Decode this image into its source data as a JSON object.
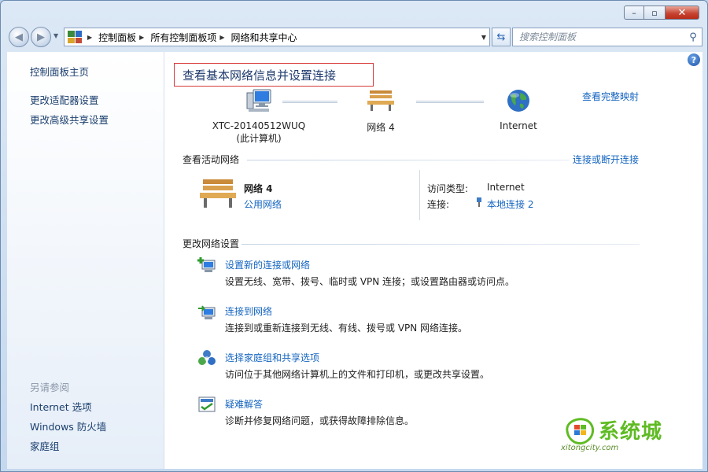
{
  "window": {
    "min_label": "–",
    "max_label": "▫",
    "close_label": "✕"
  },
  "navbar": {
    "breadcrumb": [
      "控制面板",
      "所有控制面板项",
      "网络和共享中心"
    ],
    "search_placeholder": "搜索控制面板"
  },
  "sidebar": {
    "home": "控制面板主页",
    "items": [
      "更改适配器设置",
      "更改高级共享设置"
    ],
    "see_also_heading": "另请参阅",
    "see_also": [
      "Internet 选项",
      "Windows 防火墙",
      "家庭组"
    ]
  },
  "main": {
    "title": "查看基本网络信息并设置连接",
    "full_map_link": "查看完整映射",
    "map": {
      "computer_name": "XTC-20140512WUQ",
      "computer_sub": "(此计算机)",
      "network_name": "网络  4",
      "internet": "Internet"
    },
    "active": {
      "heading": "查看活动网络",
      "connect_link": "连接或断开连接",
      "network_name": "网络  4",
      "network_type": "公用网络",
      "access_label": "访问类型:",
      "access_value": "Internet",
      "conn_label": "连接:",
      "conn_value": "本地连接 2"
    },
    "change": {
      "heading": "更改网络设置",
      "tasks": [
        {
          "title": "设置新的连接或网络",
          "desc": "设置无线、宽带、拨号、临时或 VPN 连接；或设置路由器或访问点。"
        },
        {
          "title": "连接到网络",
          "desc": "连接到或重新连接到无线、有线、拨号或 VPN 网络连接。"
        },
        {
          "title": "选择家庭组和共享选项",
          "desc": "访问位于其他网络计算机上的文件和打印机，或更改共享设置。"
        },
        {
          "title": "疑难解答",
          "desc": "诊断并修复网络问题，或获得故障排除信息。"
        }
      ]
    }
  },
  "watermark": {
    "text": "系统城",
    "sub": "xitongcity.com"
  },
  "colors": {
    "link": "#1565c0",
    "title": "#1e3a6d",
    "highlight_border": "#d83a3a"
  }
}
